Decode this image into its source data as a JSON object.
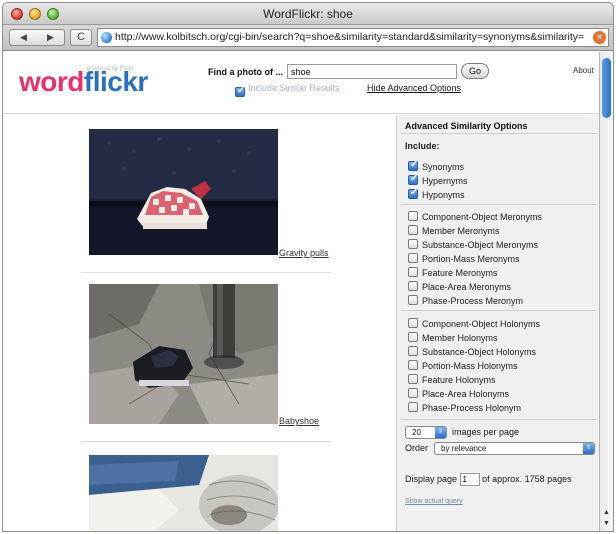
{
  "window": {
    "title": "WordFlickr: shoe"
  },
  "toolbar": {
    "back_label": "◀",
    "forward_label": "▶",
    "reload_label": "C",
    "url": "http://www.kolbitsch.org/cgi-bin/search?q=shoe&similarity=standard&similarity=synonyms&similarity="
  },
  "header": {
    "logo_word": "word",
    "logo_flickr": "flickr",
    "logo_small": "powered by Flickr",
    "find_label": "Find a photo of ...",
    "search_value": "shoe",
    "go_label": "Go",
    "about_label": "About",
    "include_similar_label": "Include Similar Results",
    "include_similar_checked": true,
    "advanced_link": "Hide Advanced Options"
  },
  "results": [
    {
      "caption": "Gravity pulls"
    },
    {
      "caption": "Babyshoe"
    },
    {
      "caption": ""
    }
  ],
  "panel": {
    "title": "Advanced Similarity Options",
    "include_label": "Include:",
    "group1": [
      {
        "label": "Synonyms",
        "checked": true
      },
      {
        "label": "Hypernyms",
        "checked": true
      },
      {
        "label": "Hyponyms",
        "checked": true
      }
    ],
    "group2": [
      {
        "label": "Component-Object Meronyms",
        "checked": false
      },
      {
        "label": "Member Meronyms",
        "checked": false
      },
      {
        "label": "Substance-Object Meronyms",
        "checked": false
      },
      {
        "label": "Portion-Mass Meronyms",
        "checked": false
      },
      {
        "label": "Feature Meronyms",
        "checked": false
      },
      {
        "label": "Place-Area Meronyms",
        "checked": false
      },
      {
        "label": "Phase-Process Meronym",
        "checked": false
      }
    ],
    "group3": [
      {
        "label": "Component-Object Holonyms",
        "checked": false
      },
      {
        "label": "Member Holonyms",
        "checked": false
      },
      {
        "label": "Substance-Object Holonyms",
        "checked": false
      },
      {
        "label": "Portion-Mass Holonyms",
        "checked": false
      },
      {
        "label": "Feature Holonyms",
        "checked": false
      },
      {
        "label": "Place-Area Holonyms",
        "checked": false
      },
      {
        "label": "Phase-Process Holonym",
        "checked": false
      }
    ],
    "per_page_value": "20",
    "per_page_label": "images per page",
    "order_label": "Order",
    "order_value": "by relevance",
    "display_page_prefix": "Display page",
    "display_page_value": "1",
    "display_page_suffix": "of approx. 1758 pages",
    "show_query_link": "Show actual query"
  }
}
